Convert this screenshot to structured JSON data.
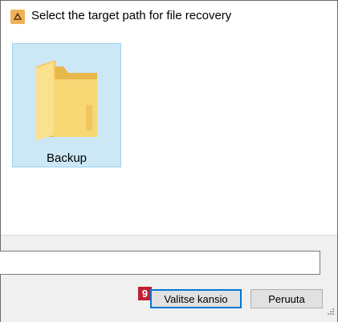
{
  "window": {
    "title": "Select the target path for file recovery"
  },
  "content": {
    "items": [
      {
        "label": "Backup",
        "icon": "folder-icon",
        "selected": true
      }
    ]
  },
  "footer": {
    "path_value": "",
    "step_badge": "9",
    "select_folder_label": "Valitse kansio",
    "cancel_label": "Peruuta"
  },
  "colors": {
    "selection_bg": "#cce8f7",
    "selection_border": "#99d1ef",
    "folder_yellow": "#f8d775",
    "badge_red": "#c21f32",
    "focus_blue": "#0078d7"
  }
}
